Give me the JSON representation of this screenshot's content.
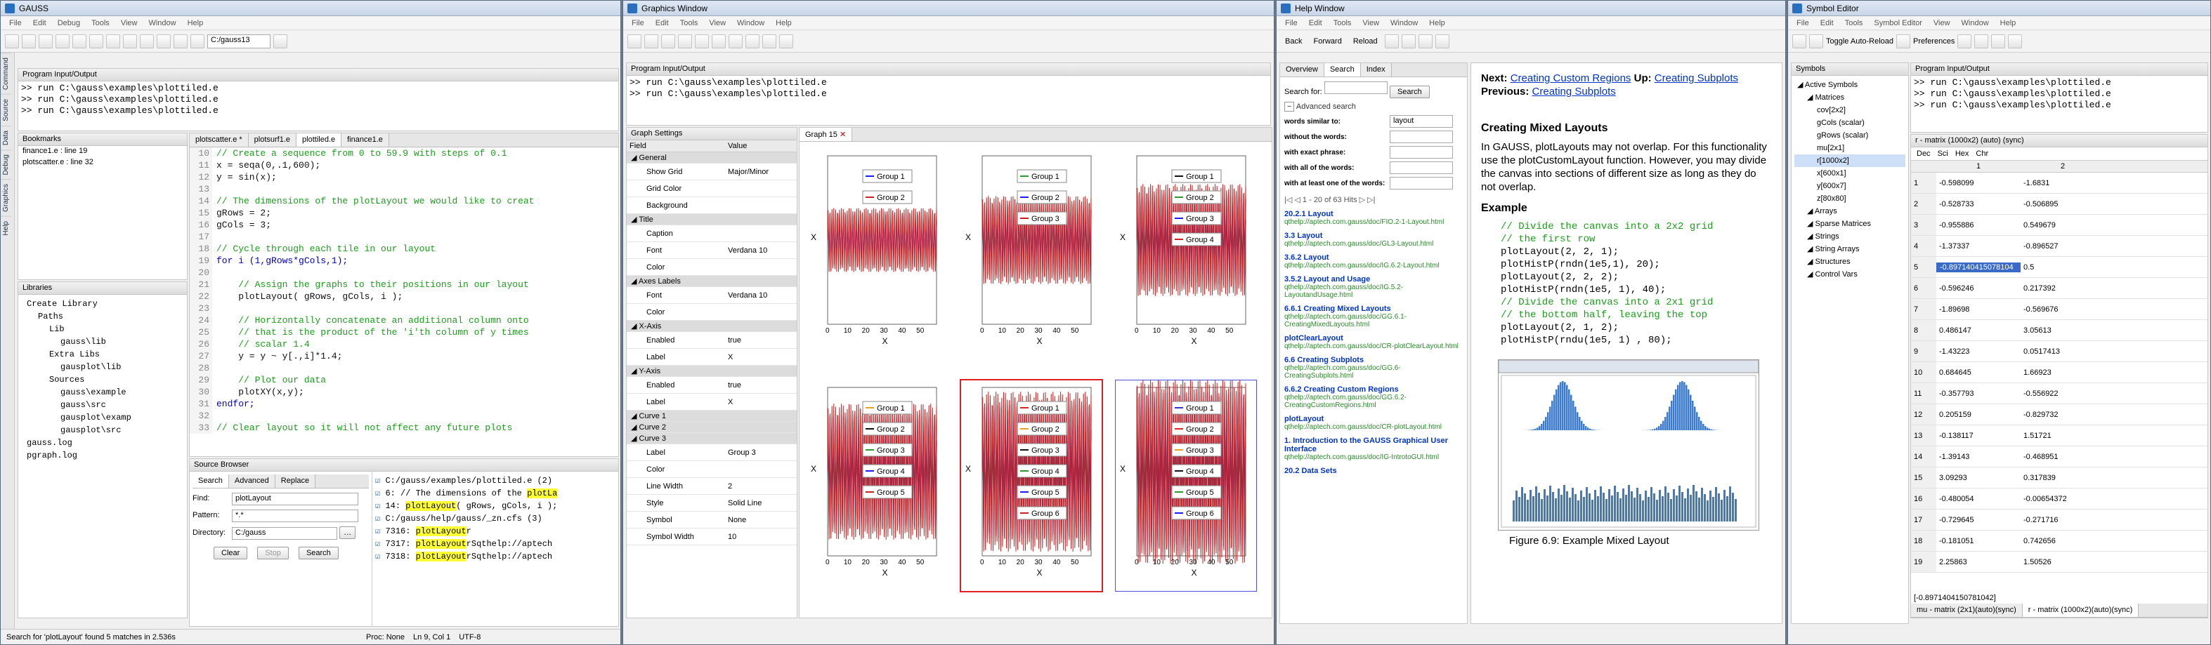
{
  "gauss": {
    "title": "GAUSS",
    "menu": [
      "File",
      "Edit",
      "Debug",
      "Tools",
      "View",
      "Window",
      "Help"
    ],
    "dir": "C:/gauss13",
    "sidebar_tabs": [
      "Command",
      "Source",
      "Data",
      "Debug",
      "Graphics",
      "Help"
    ],
    "pio_title": "Program Input/Output",
    "pio_lines": [
      ">> run C:\\gauss\\examples\\plottiled.e",
      ">> run C:\\gauss\\examples\\plottiled.e",
      ">> run C:\\gauss\\examples\\plottiled.e"
    ],
    "bookmarks_title": "Bookmarks",
    "bookmarks": [
      "finance1.e : line 19",
      "plotscatter.e : line 32"
    ],
    "libraries_title": "Libraries",
    "libraries": [
      "Create Library",
      "Paths",
      "Lib",
      "gauss\\lib",
      "Extra Libs",
      "gausplot\\lib",
      "Sources",
      "gauss\\example",
      "gauss\\src",
      "gausplot\\examp",
      "gausplot\\src",
      "gauss.log",
      "pgraph.log"
    ],
    "editor_tabs": [
      "plotscatter.e *",
      "plotsurf1.e",
      "plottiled.e",
      "finance1.e"
    ],
    "code": [
      {
        "t": "// Create a sequence from 0 to 59.9 with steps of 0.1",
        "c": "comment"
      },
      {
        "t": "x = seqa(0,.1,600);",
        "c": ""
      },
      {
        "t": "y = sin(x);",
        "c": ""
      },
      {
        "t": "",
        "c": ""
      },
      {
        "t": "// The dimensions of the plotLayout we would like to creat",
        "c": "comment"
      },
      {
        "t": "gRows = 2;",
        "c": ""
      },
      {
        "t": "gCols = 3;",
        "c": ""
      },
      {
        "t": "",
        "c": ""
      },
      {
        "t": "// Cycle through each tile in our layout",
        "c": "comment"
      },
      {
        "t": "for i (1,gRows*gCols,1);",
        "c": "kw"
      },
      {
        "t": "",
        "c": ""
      },
      {
        "t": "    // Assign the graphs to their positions in our layout",
        "c": "comment"
      },
      {
        "t": "    plotLayout( gRows, gCols, i );",
        "c": ""
      },
      {
        "t": "",
        "c": ""
      },
      {
        "t": "    // Horizontally concatenate an additional column onto",
        "c": "comment"
      },
      {
        "t": "    // that is the product of the 'i'th column of y times",
        "c": "comment"
      },
      {
        "t": "    // scalar 1.4",
        "c": "comment"
      },
      {
        "t": "    y = y ~ y[.,i]*1.4;",
        "c": ""
      },
      {
        "t": "",
        "c": ""
      },
      {
        "t": "    // Plot our data",
        "c": "comment"
      },
      {
        "t": "    plotXY(x,y);",
        "c": ""
      },
      {
        "t": "endfor;",
        "c": "kw"
      },
      {
        "t": "",
        "c": ""
      },
      {
        "t": "// Clear layout so it will not affect any future plots",
        "c": "comment"
      }
    ],
    "line_numbers": [
      "10",
      "11",
      "12",
      "13",
      "14",
      "15",
      "16",
      "17",
      "18",
      "19",
      "20",
      "21",
      "22",
      "23",
      "24",
      "25",
      "26",
      "27",
      "28",
      "29",
      "30",
      "31",
      "32",
      "33"
    ],
    "sb_title": "Source Browser",
    "sb_tabs": [
      "Search",
      "Advanced",
      "Replace"
    ],
    "find_label": "Find:",
    "find_value": "plotLayout",
    "pattern_label": "Pattern:",
    "pattern_value": "*.*",
    "dir_label": "Directory:",
    "dir_value": "C:/gauss",
    "btn_clear": "Clear",
    "btn_stop": "Stop",
    "btn_search": "Search",
    "results": [
      {
        "pre": "C:/gauss/examples/plottiled.e (2)",
        "hl": "",
        "post": ""
      },
      {
        "pre": "6: // The dimensions of the ",
        "hl": "plotLa",
        "post": ""
      },
      {
        "pre": "14: ",
        "hl": "plotLayout",
        "post": "( gRows, gCols, i );"
      },
      {
        "pre": "C:/gauss/help/gauss/_zn.cfs (3)",
        "hl": "",
        "post": ""
      },
      {
        "pre": "7316: ",
        "hl": "plotLayout",
        "post": "\u0001r"
      },
      {
        "pre": "7317: ",
        "hl": "plotLayout",
        "post": "\u0001rSqthelp://aptech"
      },
      {
        "pre": "7318: ",
        "hl": "plotLayout",
        "post": "\u0001rSqthelp://aptech"
      }
    ],
    "status": "Search for 'plotLayout' found 5 matches in 2.536s",
    "proc": "Proc: None",
    "pos": "Ln 9, Col 1",
    "enc": "UTF-8"
  },
  "graphics": {
    "title": "Graphics Window",
    "menu": [
      "File",
      "Edit",
      "Tools",
      "View",
      "Window",
      "Help"
    ],
    "pio_title": "Program Input/Output",
    "pio_lines": [
      ">> run C:\\gauss\\examples\\plottiled.e",
      ">> run C:\\gauss\\examples\\plottiled.e"
    ],
    "settings_title": "Graph Settings",
    "col_field": "Field",
    "col_value": "Value",
    "settings": [
      {
        "f": "General",
        "v": "",
        "sec": true
      },
      {
        "f": "Show Grid",
        "v": "Major/Minor",
        "sec": false
      },
      {
        "f": "Grid Color",
        "v": "",
        "sec": false
      },
      {
        "f": "Background",
        "v": "",
        "sec": false
      },
      {
        "f": "Title",
        "v": "",
        "sec": true
      },
      {
        "f": "Caption",
        "v": "",
        "sec": false
      },
      {
        "f": "Font",
        "v": "Verdana 10",
        "sec": false
      },
      {
        "f": "Color",
        "v": "",
        "sec": false
      },
      {
        "f": "Axes Labels",
        "v": "",
        "sec": true
      },
      {
        "f": "Font",
        "v": "Verdana 10",
        "sec": false
      },
      {
        "f": "Color",
        "v": "",
        "sec": false
      },
      {
        "f": "X-Axis",
        "v": "",
        "sec": true
      },
      {
        "f": "Enabled",
        "v": "true",
        "sec": false
      },
      {
        "f": "Label",
        "v": "X",
        "sec": false
      },
      {
        "f": "Y-Axis",
        "v": "",
        "sec": true
      },
      {
        "f": "Enabled",
        "v": "true",
        "sec": false
      },
      {
        "f": "Label",
        "v": "X",
        "sec": false
      },
      {
        "f": "Curve 1",
        "v": "",
        "sec": true
      },
      {
        "f": "Curve 2",
        "v": "",
        "sec": true
      },
      {
        "f": "Curve 3",
        "v": "",
        "sec": true
      },
      {
        "f": "Label",
        "v": "Group 3",
        "sec": false
      },
      {
        "f": "Color",
        "v": "",
        "sec": false
      },
      {
        "f": "Line Width",
        "v": "2",
        "sec": false
      },
      {
        "f": "Style",
        "v": "Solid Line",
        "sec": false
      },
      {
        "f": "Symbol",
        "v": "None",
        "sec": false
      },
      {
        "f": "Symbol Width",
        "v": "10",
        "sec": false
      }
    ],
    "graph_tab": "Graph 15",
    "xlabel": "X",
    "xticks": [
      "0",
      "10",
      "20",
      "30",
      "40",
      "50"
    ],
    "group_label": "Group",
    "plots": [
      {
        "colors": [
          "#1a1aff",
          "#cc2020"
        ],
        "n": 2
      },
      {
        "colors": [
          "#2a9a2a",
          "#1a1aff",
          "#cc2020"
        ],
        "n": 3
      },
      {
        "colors": [
          "#111111",
          "#2a9a2a",
          "#1a1aff",
          "#cc2020"
        ],
        "n": 4
      },
      {
        "colors": [
          "#e8a020",
          "#111111",
          "#2a9a2a",
          "#1a1aff",
          "#cc2020"
        ],
        "n": 5
      },
      {
        "colors": [
          "#dd2222",
          "#e8a020",
          "#111111",
          "#2a9a2a",
          "#1a1aff",
          "#cc2020"
        ],
        "n": 6
      },
      {
        "colors": [
          "#3333cc",
          "#dd2222",
          "#e8a020",
          "#111111",
          "#2a9a2a",
          "#1a1aff",
          "#cc2020"
        ],
        "n": 7
      }
    ]
  },
  "help": {
    "title": "Help Window",
    "menu": [
      "File",
      "Edit",
      "Tools",
      "View",
      "Window",
      "Help"
    ],
    "nav": [
      "Back",
      "Forward",
      "Reload"
    ],
    "tabs": [
      "Overview",
      "Search",
      "Index"
    ],
    "search_for": "Search for:",
    "search_btn": "Search",
    "adv": "Advanced search",
    "fields": [
      {
        "l": "words similar to:",
        "v": "layout"
      },
      {
        "l": "without the words:",
        "v": ""
      },
      {
        "l": "with exact phrase:",
        "v": ""
      },
      {
        "l": "with all of the words:",
        "v": ""
      },
      {
        "l": "with at least one of the words:",
        "v": ""
      }
    ],
    "hits": "1 - 20 of 63 Hits",
    "results": [
      {
        "t": "20.2.1 Layout",
        "u": "qthelp://aptech.com.gauss/doc/FIO.2-1-Layout.html"
      },
      {
        "t": "3.3 Layout",
        "u": "qthelp://aptech.com.gauss/doc/GL3-Layout.html"
      },
      {
        "t": "3.6.2 Layout",
        "u": "qthelp://aptech.com.gauss/doc/IG.6.2-Layout.html"
      },
      {
        "t": "3.5.2 Layout and Usage",
        "u": "qthelp://aptech.com.gauss/doc/IG.5.2-LayoutandUsage.html"
      },
      {
        "t": "6.6.1 Creating Mixed Layouts",
        "u": "qthelp://aptech.com.gauss/doc/GG.6.1-CreatingMixedLayouts.html"
      },
      {
        "t": "plotClearLayout",
        "u": "qthelp://aptech.com.gauss/doc/CR-plotClearLayout.html"
      },
      {
        "t": "6.6 Creating Subplots",
        "u": "qthelp://aptech.com.gauss/doc/GG.6-CreatingSubplots.html"
      },
      {
        "t": "6.6.2 Creating Custom Regions",
        "u": "qthelp://aptech.com.gauss/doc/GG.6.2-CreatingCustomRegions.html"
      },
      {
        "t": "plotLayout",
        "u": "qthelp://aptech.com.gauss/doc/CR-plotLayout.html"
      },
      {
        "t": "1. Introduction to the GAUSS Graphical User Interface",
        "u": "qthelp://aptech.com.gauss/doc/IG-IntrotoGUI.html"
      },
      {
        "t": "20.2 Data Sets",
        "u": ""
      }
    ],
    "next_label": "Next:",
    "next_link": "Creating Custom Regions",
    "up_label": "Up:",
    "up_link": "Creating Subplots",
    "prev_label": "Previous:",
    "prev_link": "Creating Subplots",
    "heading": "Creating Mixed Layouts",
    "para": "In GAUSS, plotLayouts may not overlap. For this functionality use the plotCustomLayout function. However, you may divide the canvas into sections of different size as long as they do not overlap.",
    "example": "Example",
    "code": [
      {
        "t": "// Divide the canvas into a 2x2 grid",
        "c": "comment"
      },
      {
        "t": "// the first row",
        "c": "comment"
      },
      {
        "t": "plotLayout(2, 2, 1);",
        "c": ""
      },
      {
        "t": "plotHistP(rndn(1e5,1), 20);",
        "c": ""
      },
      {
        "t": "plotLayout(2, 2, 2);",
        "c": ""
      },
      {
        "t": "plotHistP(rndn(1e5, 1), 40);",
        "c": ""
      },
      {
        "t": "// Divide the canvas into a 2x1 grid",
        "c": "comment"
      },
      {
        "t": "// the bottom half, leaving the top",
        "c": "comment"
      },
      {
        "t": "plotLayout(2, 1, 2);",
        "c": ""
      },
      {
        "t": "plotHistP(rndu(1e5, 1) , 80);",
        "c": ""
      }
    ],
    "figure_caption": "Figure 6.9: Example Mixed Layout"
  },
  "symbol": {
    "title": "Symbol Editor",
    "menu": [
      "File",
      "Edit",
      "Tools",
      "Symbol Editor",
      "View",
      "Window",
      "Help"
    ],
    "toggle": "Toggle Auto-Reload",
    "prefs": "Preferences",
    "symbols_title": "Symbols",
    "tree": [
      {
        "t": "Active Symbols",
        "d": 0
      },
      {
        "t": "Matrices",
        "d": 1
      },
      {
        "t": "cov[2x2]",
        "d": 2
      },
      {
        "t": "gCols (scalar)",
        "d": 2
      },
      {
        "t": "gRows (scalar)",
        "d": 2
      },
      {
        "t": "mu[2x1]",
        "d": 2
      },
      {
        "t": "r[1000x2]",
        "d": 2
      },
      {
        "t": "x[600x1]",
        "d": 2
      },
      {
        "t": "y[600x7]",
        "d": 2
      },
      {
        "t": "z[80x80]",
        "d": 2
      },
      {
        "t": "Arrays",
        "d": 1
      },
      {
        "t": "Sparse Matrices",
        "d": 1
      },
      {
        "t": "Strings",
        "d": 1
      },
      {
        "t": "String Arrays",
        "d": 1
      },
      {
        "t": "Structures",
        "d": 1
      },
      {
        "t": "Control Vars",
        "d": 1
      }
    ],
    "pio_title": "Program Input/Output",
    "pio_lines": [
      ">> run C:\\gauss\\examples\\plottiled.e",
      ">> run C:\\gauss\\examples\\plottiled.e",
      ">> run C:\\gauss\\examples\\plottiled.e"
    ],
    "matrix_title": "r - matrix (1000x2) (auto) (sync)",
    "fmt": [
      "Dec",
      "Sci",
      "Hex",
      "Chr"
    ],
    "cols": [
      "1",
      "2"
    ],
    "rows": [
      [
        "1",
        "-0.598099",
        "-1.6831"
      ],
      [
        "2",
        "-0.528733",
        "-0.506895"
      ],
      [
        "3",
        "-0.955886",
        "0.549679"
      ],
      [
        "4",
        "-1.37337",
        "-0.896527"
      ],
      [
        "5",
        "-0.897140415078104",
        "0.5"
      ],
      [
        "6",
        "-0.596246",
        "0.217392"
      ],
      [
        "7",
        "-1.89698",
        "-0.569676"
      ],
      [
        "8",
        "0.486147",
        "3.05613"
      ],
      [
        "9",
        "-1.43223",
        "0.0517413"
      ],
      [
        "10",
        "0.684645",
        "1.66923"
      ],
      [
        "11",
        "-0.357793",
        "-0.556922"
      ],
      [
        "12",
        "0.205159",
        "-0.829732"
      ],
      [
        "13",
        "-0.138117",
        "1.51721"
      ],
      [
        "14",
        "-1.39143",
        "-0.468951"
      ],
      [
        "15",
        "3.09293",
        "0.317839"
      ],
      [
        "16",
        "-0.480054",
        "-0.00654372"
      ],
      [
        "17",
        "-0.729645",
        "-0.271716"
      ],
      [
        "18",
        "-0.181051",
        "0.742656"
      ],
      [
        "19",
        "2.25863",
        "1.50526"
      ]
    ],
    "cell_value": "[-0.8971404150781042]",
    "bottom_tabs": [
      "mu - matrix (2x1)(auto)(sync)",
      "r - matrix (1000x2)(auto)(sync)"
    ]
  }
}
